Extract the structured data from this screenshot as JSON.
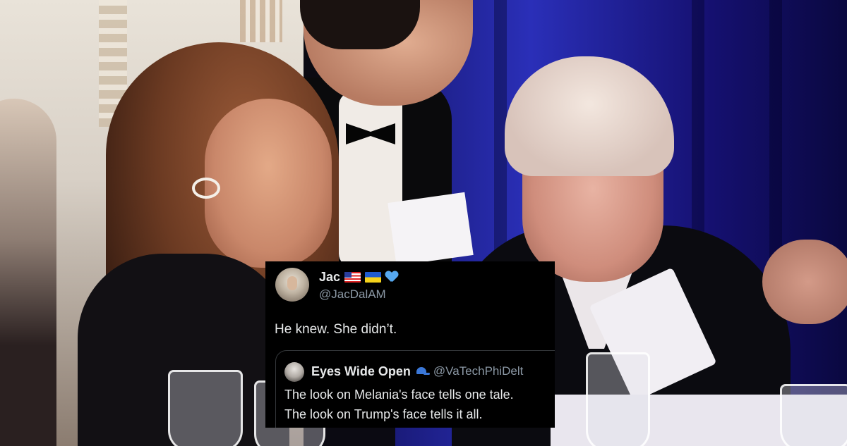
{
  "tweet": {
    "author_name": "Jac",
    "author_handle": "@JacDalAM",
    "badges": [
      "us-flag-icon",
      "ukraine-flag-icon",
      "blue-heart-icon"
    ],
    "text": "He knew. She didn’t."
  },
  "quoted_tweet": {
    "author_name": "Eyes Wide Open",
    "badge": "cap-icon",
    "author_handle": "@VaTechPhiDelt",
    "line1": "The look on Melania's face tells one tale.",
    "line2": "The look on Trump's face tells it all."
  },
  "colors": {
    "tweet_bg": "#000000",
    "text_primary": "#e7e9ea",
    "text_secondary": "#8b98a5",
    "border": "#333639",
    "curtain_blue": "#2a2fb8"
  }
}
